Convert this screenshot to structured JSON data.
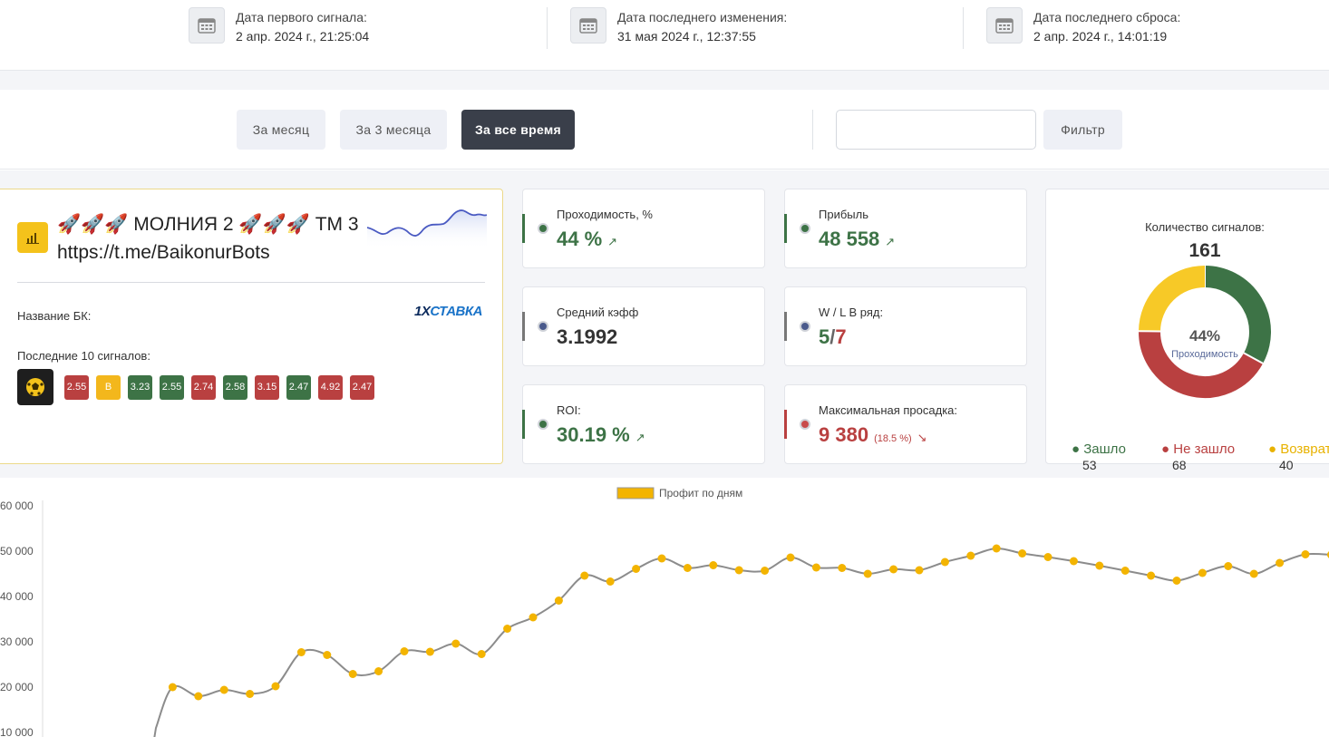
{
  "header": {
    "first_signal": {
      "label": "Дата первого сигнала:",
      "value": "2 апр. 2024 г., 21:25:04"
    },
    "last_change": {
      "label": "Дата последнего изменения:",
      "value": "31 мая 2024 г., 12:37:55"
    },
    "last_reset": {
      "label": "Дата последнего сброса:",
      "value": "2 апр. 2024 г., 14:01:19"
    }
  },
  "filters": {
    "periods": [
      "За месяц",
      "За 3 месяца",
      "За все время"
    ],
    "active_period": "За все время",
    "search_value": "",
    "filter_button": "Фильтр"
  },
  "bot": {
    "title": "🚀🚀🚀 МОЛНИЯ 2 🚀🚀🚀 ТМ 3",
    "link": "https://t.me/BaikonurBots",
    "bk_label": "Название БК:",
    "bk_name": {
      "part1": "1X",
      "part2": "СТАВКА"
    },
    "last_signals_label": "Последние 10 сигналов:",
    "signals": [
      {
        "v": "2.55",
        "s": "l"
      },
      {
        "v": "В",
        "s": "r"
      },
      {
        "v": "3.23",
        "s": "w"
      },
      {
        "v": "2.55",
        "s": "w"
      },
      {
        "v": "2.74",
        "s": "l"
      },
      {
        "v": "2.58",
        "s": "w"
      },
      {
        "v": "3.15",
        "s": "l"
      },
      {
        "v": "2.47",
        "s": "w"
      },
      {
        "v": "4.92",
        "s": "l"
      },
      {
        "v": "2.47",
        "s": "l"
      }
    ]
  },
  "stats": {
    "passability": {
      "label": "Проходимость, %",
      "value": "44 %"
    },
    "profit": {
      "label": "Прибыль",
      "value": "48 558"
    },
    "avg_coef": {
      "label": "Средний кэфф",
      "value": "3.1992"
    },
    "wl": {
      "label": "W / L В ряд:",
      "w": "5",
      "sep": "/",
      "l": "7"
    },
    "roi": {
      "label": "ROI:",
      "value": "30.19 %"
    },
    "drawdown": {
      "label": "Максимальная просадка:",
      "value": "9 380",
      "pct": "(18.5 %)"
    }
  },
  "signals_summary": {
    "title": "Количество сигналов:",
    "total": "161",
    "center_pct": "44%",
    "center_label": "Проходимость",
    "legend": [
      {
        "name": "Зашло",
        "value": "53",
        "color": "#3d7346"
      },
      {
        "name": "Не зашло",
        "value": "68",
        "color": "#b94040"
      },
      {
        "name": "Возврат",
        "value": "40",
        "color": "#f7c927"
      }
    ]
  },
  "colors": {
    "win": "#3d7346",
    "loss": "#b94040",
    "refund": "#f7c927",
    "line": "#8c8c8c",
    "point": "#f3b400"
  },
  "chart_data": {
    "type": "line",
    "legend": "Профит по дням",
    "y_ticks": [
      "10 000",
      "20 000",
      "30 000",
      "40 000",
      "50 000",
      "60 000"
    ],
    "ylim": [
      8000,
      60000
    ],
    "values": [
      11000,
      20000,
      18000,
      19400,
      18500,
      20200,
      27700,
      27100,
      22900,
      23500,
      27900,
      27800,
      29600,
      27300,
      32900,
      35400,
      39100,
      44600,
      43300,
      46100,
      48400,
      46300,
      46900,
      45800,
      45700,
      48600,
      46400,
      46300,
      45000,
      46000,
      45800,
      47600,
      49000,
      50600,
      49500,
      48700,
      47800,
      46800,
      45700,
      44600,
      43500,
      45200,
      46700,
      45000,
      47400,
      49300,
      49200
    ]
  }
}
